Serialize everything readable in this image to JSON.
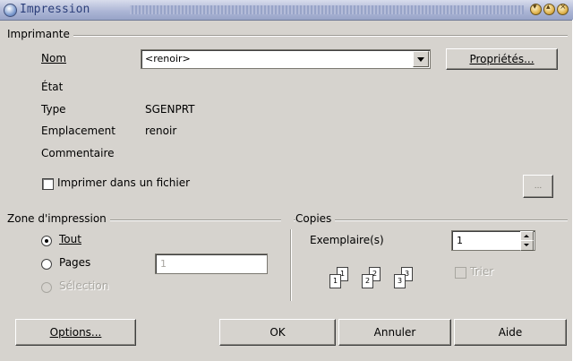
{
  "window": {
    "title": "Impression",
    "controls": [
      "minimize-button",
      "maximize-button",
      "close-button"
    ]
  },
  "printer": {
    "group_label": "Imprimante",
    "name_label": "Nom",
    "name_value": "<renoir>",
    "properties_button": "Propriétés...",
    "state_label": "État",
    "state_value": "",
    "type_label": "Type",
    "type_value": "SGENPRT",
    "location_label": "Emplacement",
    "location_value": "renoir",
    "comment_label": "Commentaire",
    "comment_value": "",
    "print_to_file_label": "Imprimer dans un fichier",
    "print_to_file_checked": false,
    "browse_button": "..."
  },
  "print_range": {
    "group_label": "Zone d'impression",
    "all_label": "Tout",
    "all_selected": true,
    "pages_label": "Pages",
    "pages_value": "1",
    "selection_label": "Sélection",
    "selection_enabled": false
  },
  "copies": {
    "group_label": "Copies",
    "count_label": "Exemplaire(s)",
    "count_value": "1",
    "collate_label": "Trier",
    "collate_enabled": false,
    "collate_illustration": [
      {
        "back": "1",
        "front": "1"
      },
      {
        "back": "2",
        "front": "2"
      },
      {
        "back": "3",
        "front": "3"
      }
    ]
  },
  "buttons": {
    "options": "Options...",
    "ok": "OK",
    "cancel": "Annuler",
    "help": "Aide"
  }
}
